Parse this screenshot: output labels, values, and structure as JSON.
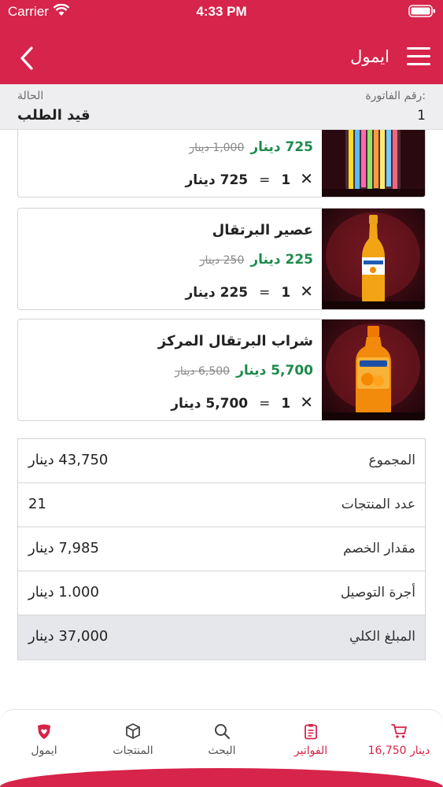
{
  "status_bar": {
    "carrier": "Carrier",
    "time": "4:33 PM"
  },
  "header": {
    "title": "ايمول"
  },
  "invoice": {
    "number_label": "رقم الفاتورة:",
    "number_value": "1",
    "status_label": "الحالة",
    "status_value": "قيد الطلب"
  },
  "products": [
    {
      "name": "",
      "price_new": "725 دينار",
      "price_old": "1,000 دينار",
      "qty": "1",
      "total": "725 دينار",
      "image": "straws"
    },
    {
      "name": "عصير البرتقال",
      "price_new": "225 دينار",
      "price_old": "250 دينار",
      "qty": "1",
      "total": "225 دينار",
      "image": "orange-juice-bottle"
    },
    {
      "name": "شراب البرتقال المركز",
      "price_new": "5,700 دينار",
      "price_old": "6,500 دينار",
      "qty": "1",
      "total": "5,700 دينار",
      "image": "orange-syrup-bottle"
    }
  ],
  "summary": [
    {
      "label": "المجموع",
      "value": "43,750 دينار"
    },
    {
      "label": "عدد المنتجات",
      "value": "21"
    },
    {
      "label": "مقدار الخصم",
      "value": "7,985 دينار"
    },
    {
      "label": "أجرة التوصيل",
      "value": "1.000 دينار"
    },
    {
      "label": "المبلغ الكلي",
      "value": "37,000 دينار"
    }
  ],
  "tabs": [
    {
      "label": "16,750 دينار",
      "icon": "cart-icon"
    },
    {
      "label": "الفواتير",
      "icon": "invoice-icon",
      "active": true
    },
    {
      "label": "البحث",
      "icon": "search-icon"
    },
    {
      "label": "المنتجات",
      "icon": "box-icon"
    },
    {
      "label": "ايمول",
      "icon": "app-logo-icon"
    }
  ],
  "colors": {
    "brand": "#d7244a",
    "price_green": "#1e8a4c"
  }
}
